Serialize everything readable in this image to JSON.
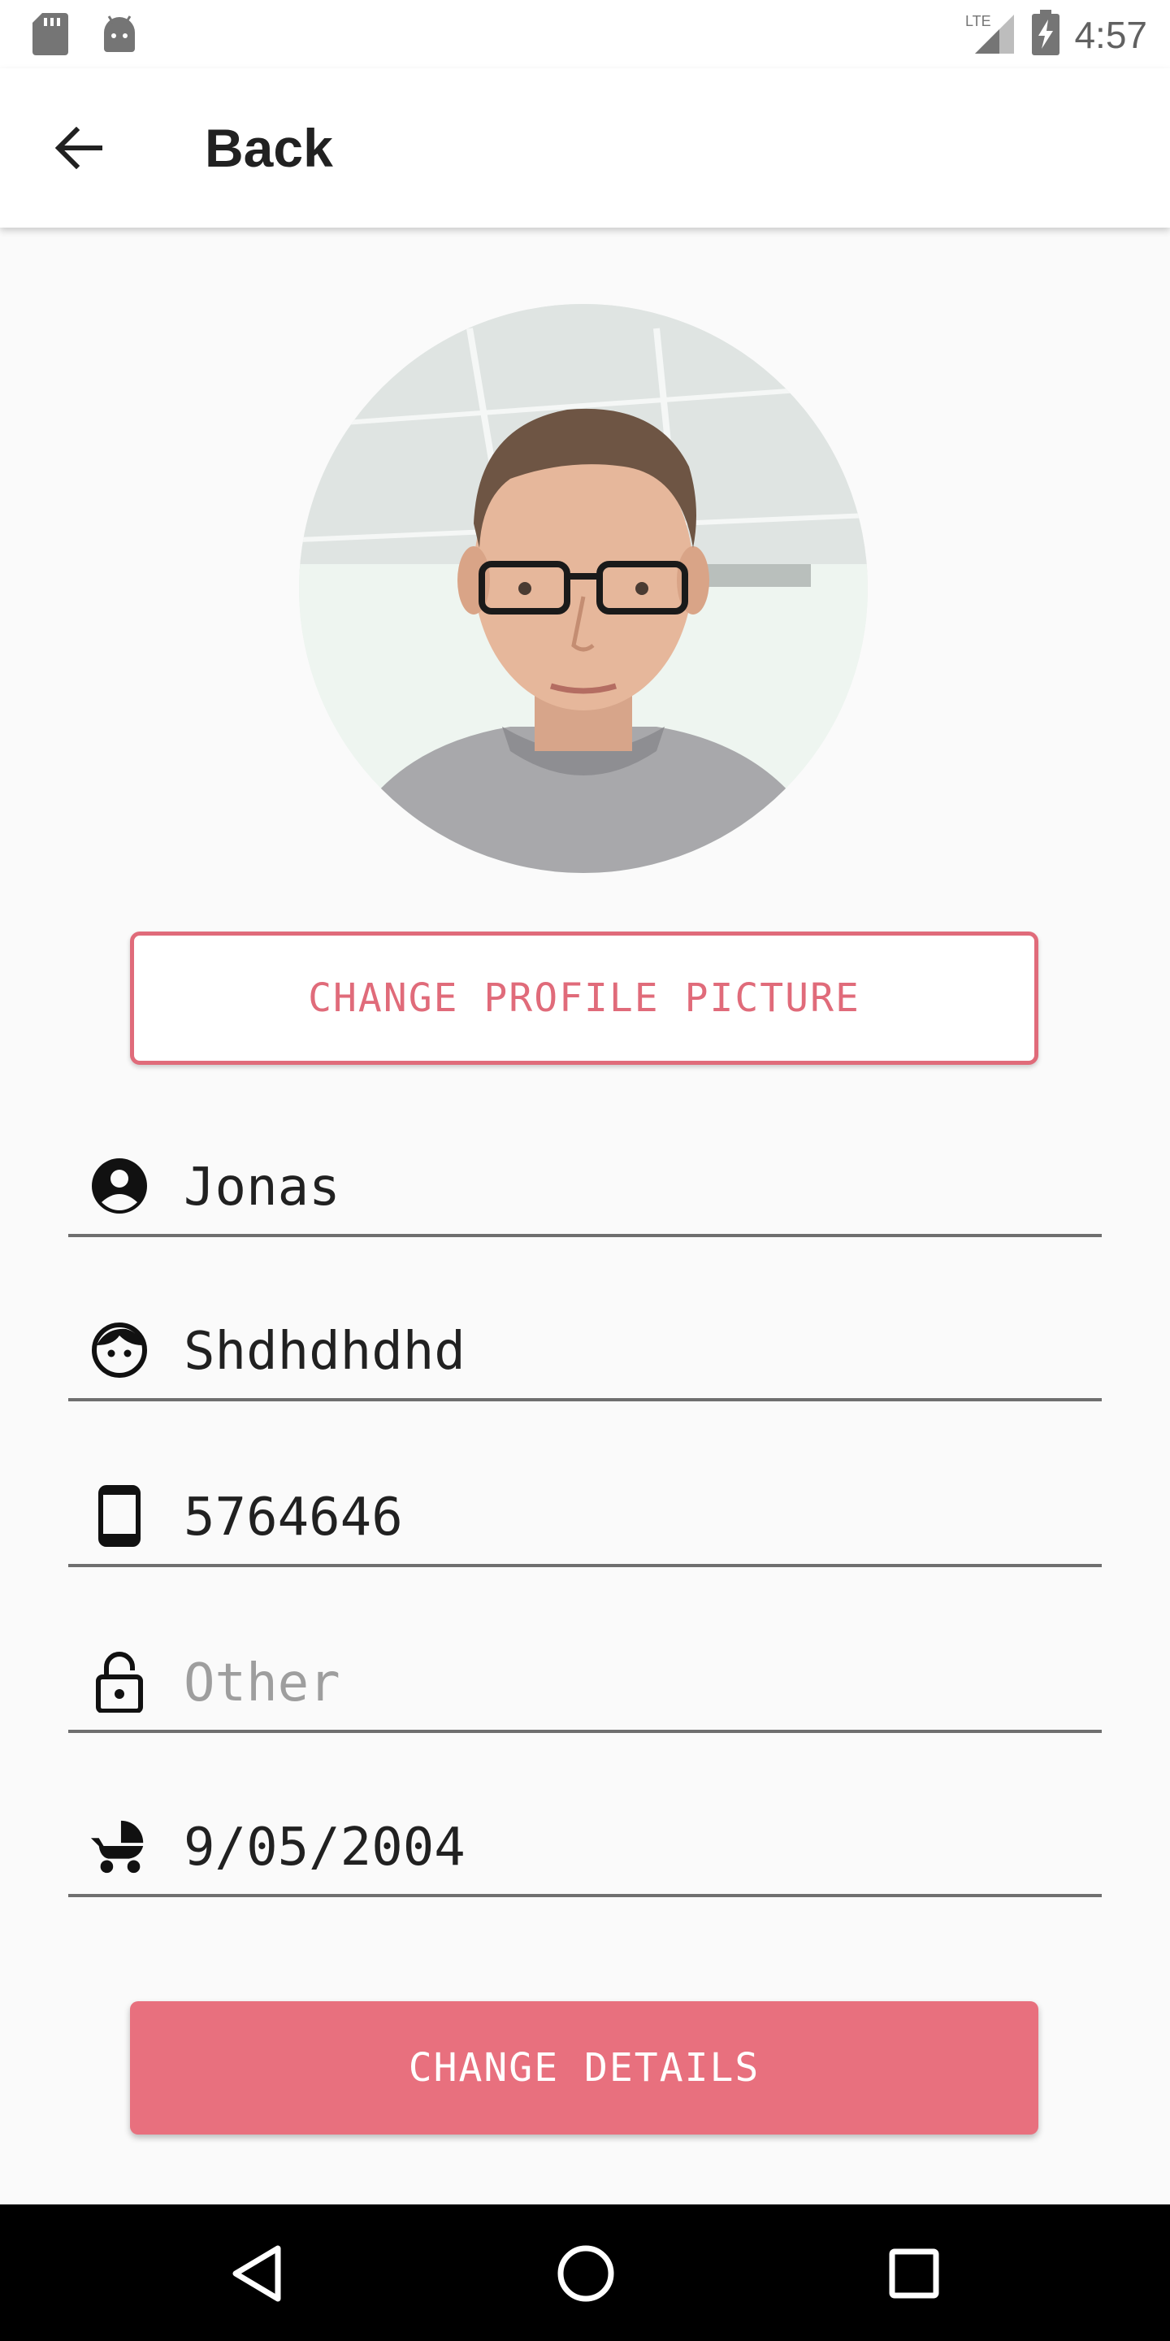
{
  "status_bar": {
    "time": "4:57",
    "left_icons": [
      "sd-card-icon",
      "android-icon"
    ],
    "right_icons": [
      "lte-signal-icon",
      "battery-charging-icon"
    ],
    "network_label": "LTE"
  },
  "app_bar": {
    "title": "Back",
    "back_icon": "arrow-back-icon"
  },
  "profile": {
    "photo": "profile-photo",
    "change_picture_label": "CHANGE PROFILE PICTURE"
  },
  "fields": [
    {
      "icon": "account-circle-icon",
      "value": "Jonas",
      "placeholder": ""
    },
    {
      "icon": "face-icon",
      "value": "Shdhdhdhd",
      "placeholder": ""
    },
    {
      "icon": "phone-icon",
      "value": "5764646",
      "placeholder": ""
    },
    {
      "icon": "lock-open-icon",
      "value": "",
      "placeholder": "Other"
    },
    {
      "icon": "stroller-icon",
      "value": "9/05/2004",
      "placeholder": ""
    }
  ],
  "actions": {
    "change_details_label": "CHANGE DETAILS"
  },
  "nav_bar": {
    "icons": [
      "nav-back-icon",
      "nav-home-icon",
      "nav-recents-icon"
    ]
  },
  "colors": {
    "accent": "#e8707e",
    "accent_outline": "#e06b7a",
    "background": "#fafafa",
    "text": "#212121"
  }
}
